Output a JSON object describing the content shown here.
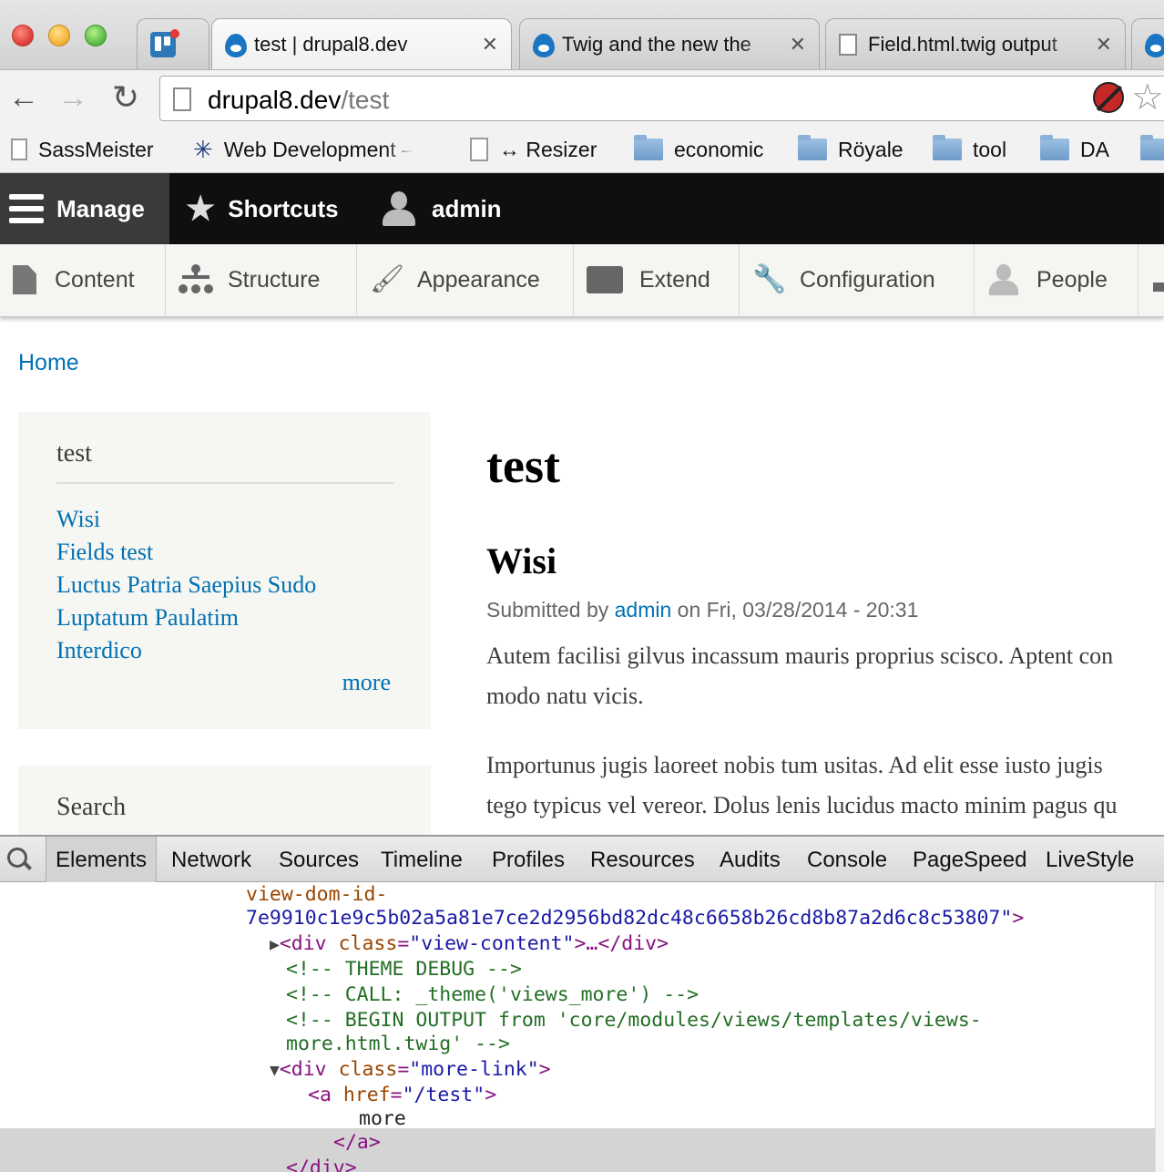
{
  "browser": {
    "tabs": [
      {
        "title": "test | drupal8.dev",
        "icon": "drupal-icon",
        "active": true
      },
      {
        "title": "Twig and the new the",
        "icon": "drupal-icon",
        "active": false
      },
      {
        "title": "Field.html.twig output",
        "icon": "document-icon",
        "active": false
      }
    ],
    "close_glyph": "✕",
    "url_host": "drupal8.dev",
    "url_path": "/test",
    "bookmarks": [
      {
        "label": "SassMeister",
        "icon": "page-icon"
      },
      {
        "label": "Web Development –",
        "icon": "jira-icon"
      },
      {
        "label": "↔ Resizer",
        "icon": "page-icon"
      },
      {
        "label": "economic",
        "icon": "folder-icon"
      },
      {
        "label": "Röyale",
        "icon": "folder-icon"
      },
      {
        "label": "tool",
        "icon": "folder-icon"
      },
      {
        "label": "DA",
        "icon": "folder-icon"
      }
    ]
  },
  "admin_toolbar": {
    "manage": "Manage",
    "shortcuts": "Shortcuts",
    "user": "admin"
  },
  "admin_tray": [
    {
      "label": "Content",
      "icon": "content-icon"
    },
    {
      "label": "Structure",
      "icon": "structure-icon"
    },
    {
      "label": "Appearance",
      "icon": "appearance-icon"
    },
    {
      "label": "Extend",
      "icon": "extend-icon"
    },
    {
      "label": "Configuration",
      "icon": "configuration-icon"
    },
    {
      "label": "People",
      "icon": "people-icon"
    }
  ],
  "breadcrumb": "Home",
  "sidebar": {
    "block_title": "test",
    "links": [
      "Wisi",
      "Fields test",
      "Luctus Patria Saepius Sudo",
      "Luptatum Paulatim",
      "Interdico"
    ],
    "more": "more",
    "search_title": "Search"
  },
  "main": {
    "page_title": "test",
    "node_title": "Wisi",
    "submitted_prefix": "Submitted by ",
    "author": "admin",
    "submitted_suffix": " on Fri, 03/28/2014 - 20:31",
    "paragraph1_line1": "Autem facilisi gilvus incassum mauris proprius scisco. Aptent con",
    "paragraph1_line2": "modo natu vicis.",
    "paragraph2_line1": "Importunus jugis laoreet nobis tum usitas. Ad elit esse iusto jugis",
    "paragraph2_line2": "tego typicus vel vereor. Dolus lenis lucidus macto minim pagus qu"
  },
  "devtools": {
    "tabs": [
      "Elements",
      "Network",
      "Sources",
      "Timeline",
      "Profiles",
      "Resources",
      "Audits",
      "Console",
      "PageSpeed",
      "LiveStyle"
    ],
    "code": {
      "l1": "view-dom-id-",
      "l2_val": "7e9910c1e9c5b02a5a81e7ce2d2956bd82dc48c6658b26cd8b87a2d6c8c53807",
      "l3_attr": "class",
      "l3_val": "\"view-content\"",
      "l3_rest": ">…</div>",
      "l4": "<!-- THEME DEBUG -->",
      "l5": "<!-- CALL: _theme('views_more') -->",
      "l6": "<!-- BEGIN OUTPUT from 'core/modules/views/templates/views-",
      "l7": "more.html.twig' -->",
      "l8_attr": "class",
      "l8_val": "\"more-link\"",
      "l9_attr": "href",
      "l9_val": "\"/test\"",
      "l10": "more",
      "l11": "</a>",
      "l12": "</div>"
    }
  }
}
